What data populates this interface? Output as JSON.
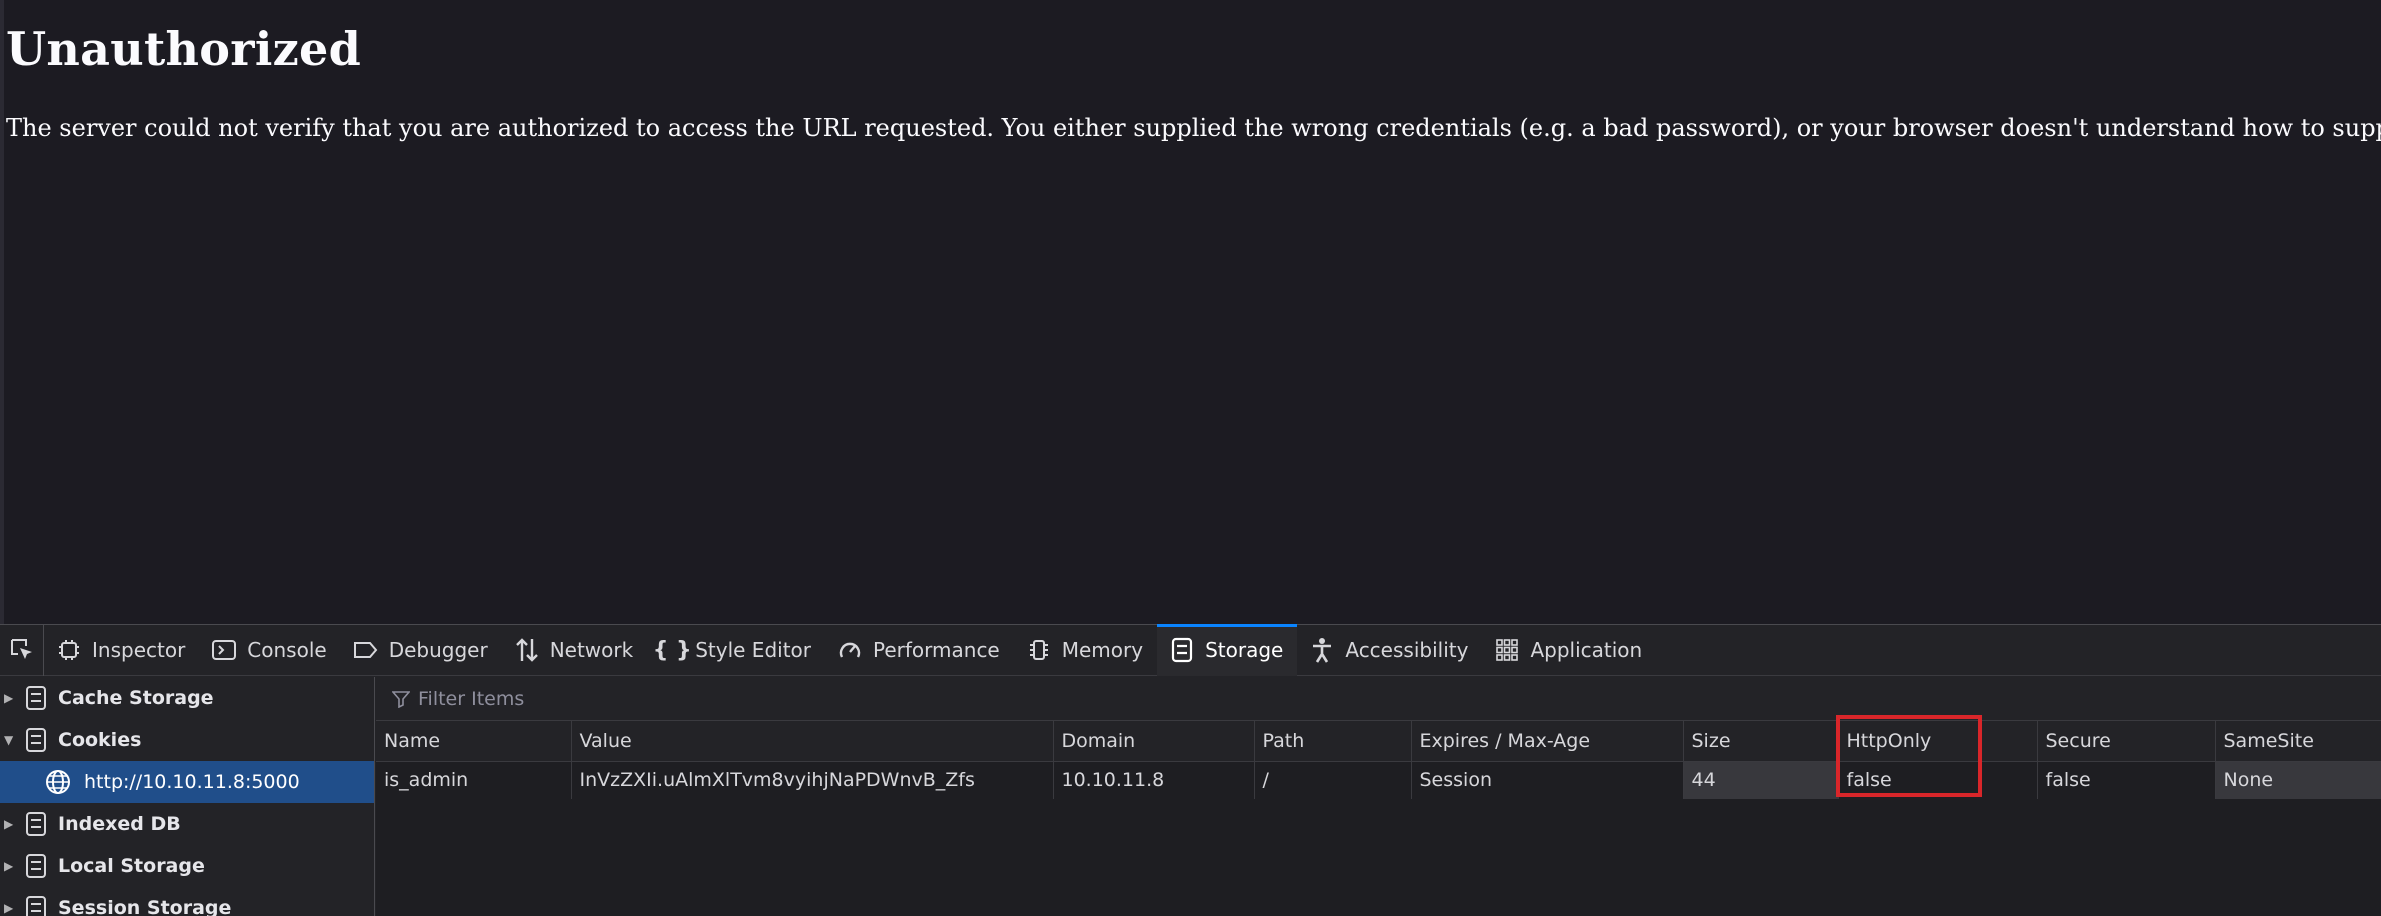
{
  "page": {
    "title": "Unauthorized",
    "message": "The server could not verify that you are authorized to access the URL requested. You either supplied the wrong credentials (e.g. a bad password), or your browser doesn't understand how to supply the credentials required."
  },
  "devtools": {
    "tabs": [
      {
        "label": "Inspector",
        "icon": "inspector-icon"
      },
      {
        "label": "Console",
        "icon": "console-icon"
      },
      {
        "label": "Debugger",
        "icon": "debugger-icon"
      },
      {
        "label": "Network",
        "icon": "network-icon"
      },
      {
        "label": "Style Editor",
        "icon": "style-editor-icon"
      },
      {
        "label": "Performance",
        "icon": "performance-icon"
      },
      {
        "label": "Memory",
        "icon": "memory-icon"
      },
      {
        "label": "Storage",
        "icon": "storage-icon",
        "active": true
      },
      {
        "label": "Accessibility",
        "icon": "accessibility-icon"
      },
      {
        "label": "Application",
        "icon": "application-icon"
      }
    ],
    "sidebar": {
      "items": [
        {
          "label": "Cache Storage"
        },
        {
          "label": "Cookies",
          "expanded": true
        },
        {
          "label": "http://10.10.11.8:5000",
          "selected": true
        },
        {
          "label": "Indexed DB"
        },
        {
          "label": "Local Storage"
        },
        {
          "label": "Session Storage"
        }
      ]
    },
    "filter": {
      "placeholder": "Filter Items"
    },
    "table": {
      "columns": [
        "Name",
        "Value",
        "Domain",
        "Path",
        "Expires / Max-Age",
        "Size",
        "HttpOnly",
        "Secure",
        "SameSite"
      ],
      "rows": [
        [
          "is_admin",
          "InVzZXIi.uAlmXlTvm8vyihjNaPDWnvB_Zfs",
          "10.10.11.8",
          "/",
          "Session",
          "44",
          "false",
          "false",
          "None"
        ]
      ]
    },
    "highlight_color": "#d9262a",
    "accent_color": "#0a84ff"
  }
}
